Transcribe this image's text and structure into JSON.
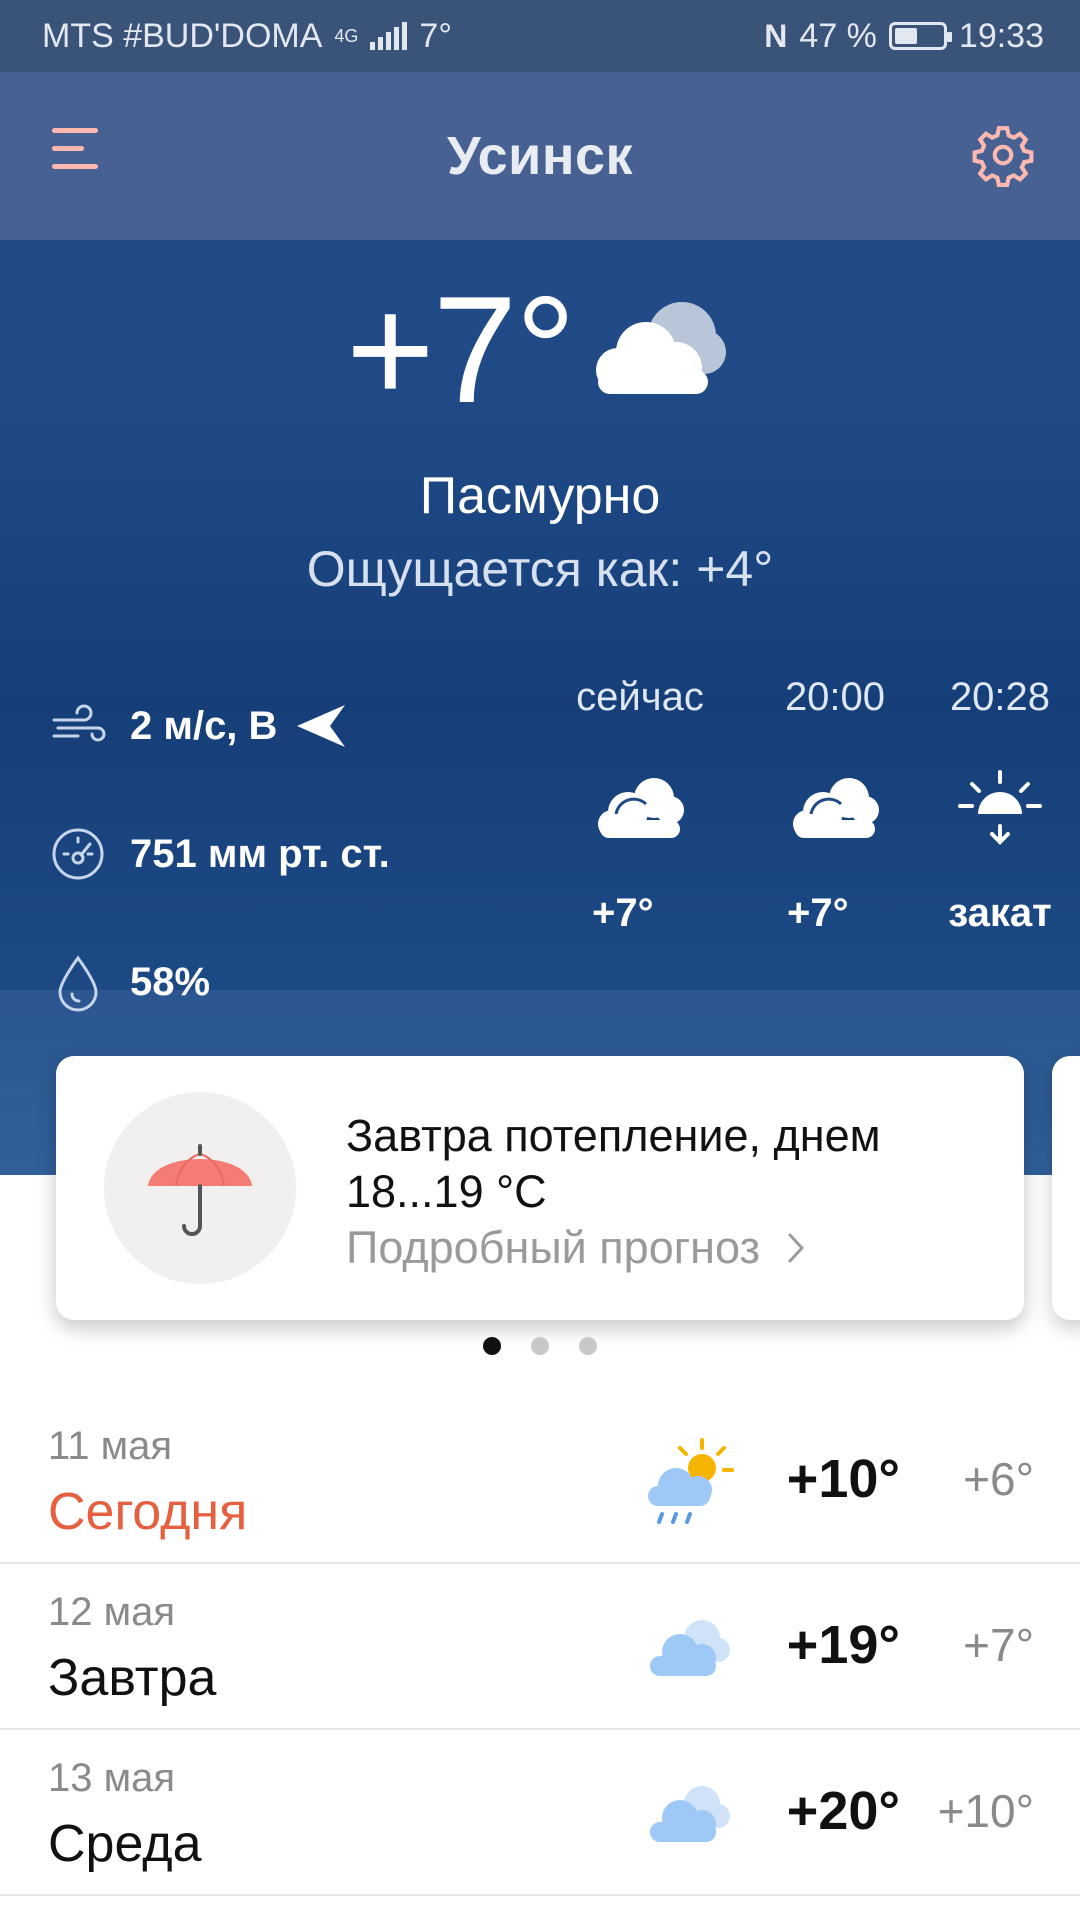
{
  "status_bar": {
    "carrier": "MTS #BUD'DOMA",
    "network": "4G",
    "temp": "7°",
    "battery": "47 %",
    "battery_level": 0.47,
    "time": "19:33"
  },
  "app_bar": {
    "city": "Усинск"
  },
  "current": {
    "temperature": "+7°",
    "condition": "Пасмурно",
    "feels_like": "Ощущается как: +4°",
    "icon": "cloudy-icon"
  },
  "details": {
    "wind": "2 м/с, В",
    "pressure": "751 мм рт. ст.",
    "humidity": "58%"
  },
  "hourly": [
    {
      "time": "сейчас",
      "icon": "cloudy-icon",
      "value": "+7°"
    },
    {
      "time": "20:00",
      "icon": "cloudy-icon",
      "value": "+7°"
    },
    {
      "time": "20:28",
      "icon": "sunset-icon",
      "value": "закат"
    }
  ],
  "card": {
    "title": "Завтра потепление, днем 18...19 °C",
    "link": "Подробный прогноз",
    "icon": "umbrella-icon"
  },
  "pager": {
    "count": 3,
    "active": 0
  },
  "colors": {
    "today": "#e6603f",
    "header": "#476292",
    "hero": "#1f4a86"
  },
  "days": [
    {
      "date": "11 мая",
      "name": "Сегодня",
      "icon": "partly-cloudy-rain-icon",
      "hi": "+10°",
      "lo": "+6°"
    },
    {
      "date": "12 мая",
      "name": "Завтра",
      "icon": "cloudy-icon",
      "hi": "+19°",
      "lo": "+7°"
    },
    {
      "date": "13 мая",
      "name": "Среда",
      "icon": "cloudy-icon",
      "hi": "+20°",
      "lo": "+10°"
    }
  ]
}
